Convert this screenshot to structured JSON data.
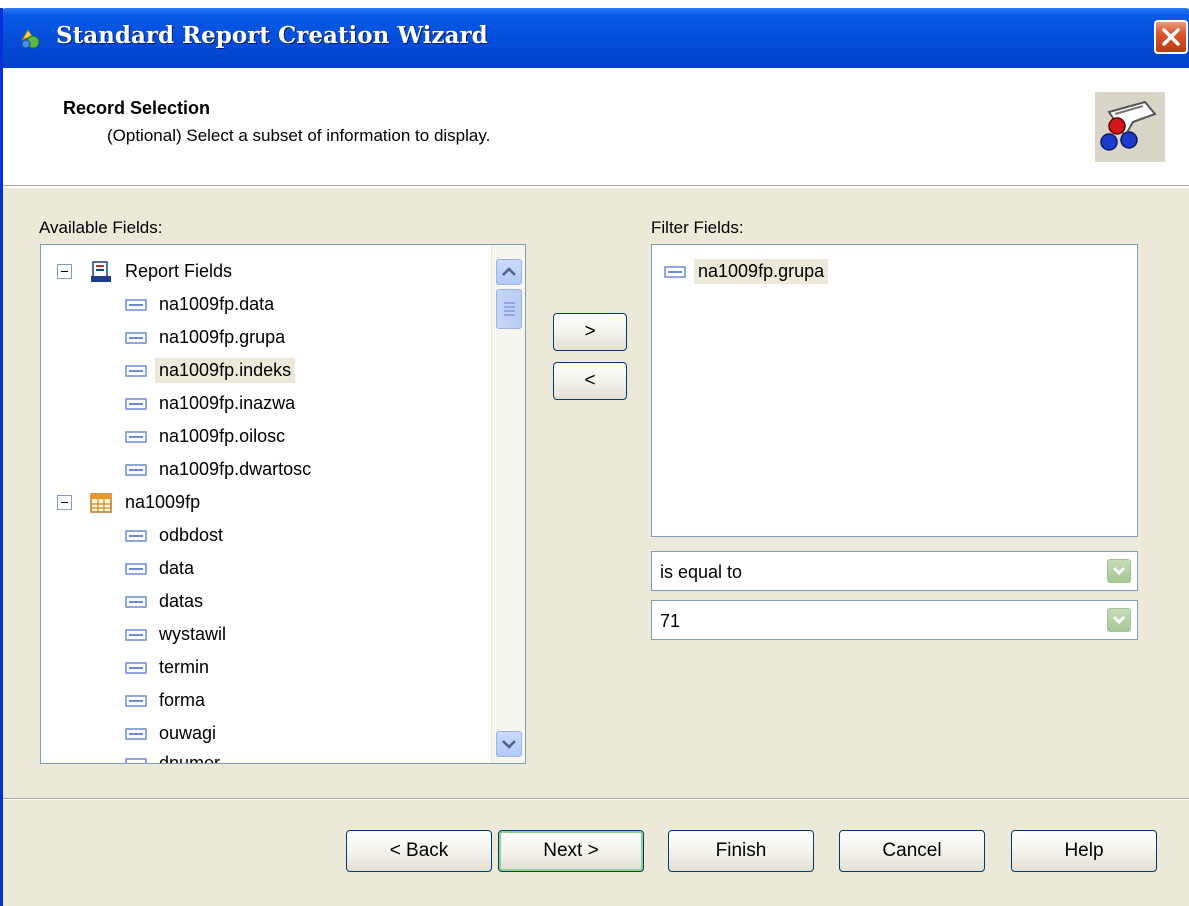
{
  "window": {
    "title": "Standard Report Creation Wizard"
  },
  "header": {
    "title": "Record Selection",
    "subtitle": "(Optional)  Select a subset of information to display."
  },
  "available": {
    "label": "Available Fields:",
    "groups": [
      {
        "label": "Report Fields"
      },
      {
        "label": "na1009fp"
      }
    ],
    "report_fields": [
      "na1009fp.data",
      "na1009fp.grupa",
      "na1009fp.indeks",
      "na1009fp.inazwa",
      "na1009fp.oilosc",
      "na1009fp.dwartosc"
    ],
    "table_fields": [
      "odbdost",
      "data",
      "datas",
      "wystawil",
      "termin",
      "forma",
      "ouwagi",
      "dnumer"
    ],
    "selected": "na1009fp.indeks"
  },
  "transfer": {
    "add_label": ">",
    "remove_label": "<"
  },
  "filter": {
    "label": "Filter Fields:",
    "items": [
      "na1009fp.grupa"
    ],
    "operator": "is equal to",
    "value": "71"
  },
  "buttons": {
    "back": "< Back",
    "next": "Next >",
    "finish": "Finish",
    "cancel": "Cancel",
    "help": "Help"
  },
  "colors": {
    "titlebar": "#0550dc",
    "window_bg": "#ece9d8",
    "close": "#d9552c"
  }
}
